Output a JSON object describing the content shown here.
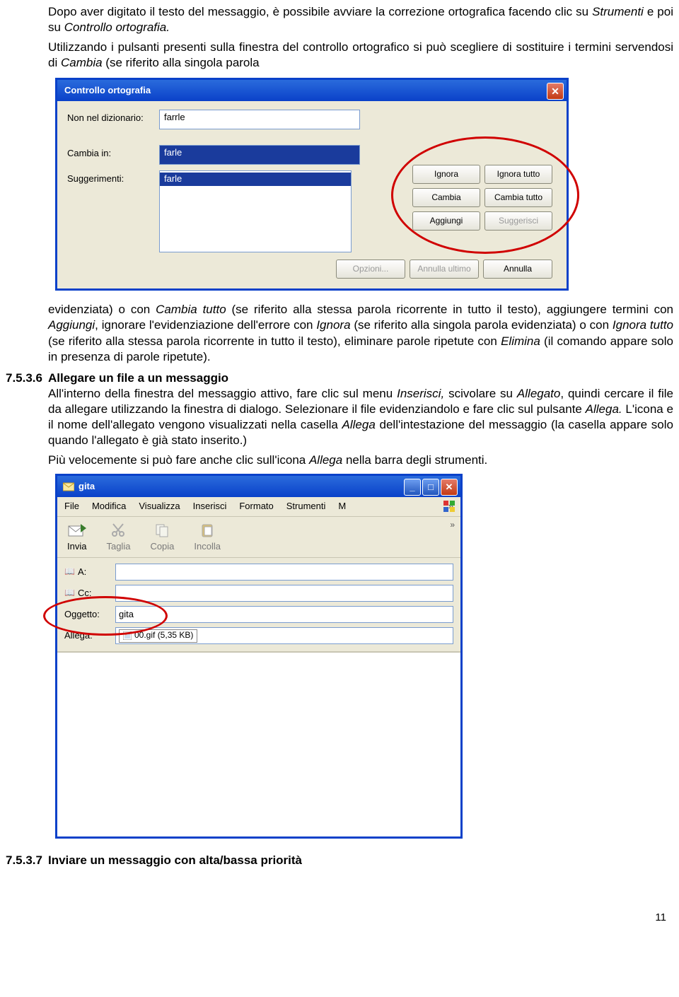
{
  "intro": {
    "p1a": "Dopo aver digitato il testo del messaggio, è possibile avviare la correzione ortografica facendo clic su ",
    "p1b": "Strumenti",
    "p1c": " e poi su ",
    "p1d": "Controllo ortografia.",
    "p2a": "Utilizzando i pulsanti presenti sulla finestra del controllo ortografico si può scegliere di sostituire i termini servendosi di ",
    "p2b": "Cambia",
    "p2c": " (se riferito alla singola parola"
  },
  "spellcheck": {
    "title": "Controllo ortografia",
    "labels": {
      "not_in_dict": "Non nel dizionario:",
      "change_to": "Cambia in:",
      "suggestions": "Suggerimenti:"
    },
    "not_in_dict_value": "farrle",
    "change_to_value": "farle",
    "suggestion_item": "farle",
    "buttons": {
      "ignore": "Ignora",
      "ignore_all": "Ignora tutto",
      "change": "Cambia",
      "change_all": "Cambia tutto",
      "add": "Aggiungi",
      "suggest": "Suggerisci",
      "options": "Opzioni...",
      "undo_last": "Annulla ultimo",
      "cancel": "Annulla"
    }
  },
  "after_spell": {
    "p1a": "evidenziata) o con ",
    "p1b": "Cambia tutto",
    "p1c": " (se riferito alla stessa parola ricorrente in tutto il testo), aggiungere termini con ",
    "p1d": "Aggiungi",
    "p1e": ", ignorare l'evidenziazione dell'errore con ",
    "p1f": "Ignora",
    "p1g": " (se riferito alla singola parola evidenziata) o con ",
    "p1h": "Ignora tutto",
    "p1i": " (se riferito alla stessa parola ricorrente in tutto il testo), eliminare parole ripetute con ",
    "p1j": "Elimina",
    "p1k": " (il comando appare solo in presenza di parole ripetute)."
  },
  "section": {
    "num": "7.5.3.6",
    "title": "Allegare un file a un messaggio",
    "p1a": "All'interno della finestra del messaggio attivo, fare clic sul menu ",
    "p1b": "Inserisci,",
    "p1c": " scivolare su ",
    "p1d": "Allegato",
    "p1e": ", quindi cercare il file da allegare utilizzando la finestra di dialogo. Selezionare il file evidenziandolo e fare clic sul pulsante ",
    "p1f": "Allega.",
    "p1g": " L'icona e il nome dell'allegato vengono visualizzati nella casella ",
    "p1h": "Allega",
    "p1i": " dell'intestazione del messaggio (la casella appare solo quando l'allegato è già stato inserito.)",
    "p2a": "Più velocemente si può fare anche clic sull'icona ",
    "p2b": "Allega",
    "p2c": " nella barra degli strumenti."
  },
  "mail": {
    "title": "gita",
    "menu": {
      "file": "File",
      "edit": "Modifica",
      "view": "Visualizza",
      "insert": "Inserisci",
      "format": "Formato",
      "tools": "Strumenti",
      "more_letter": "M"
    },
    "toolbar": {
      "send": "Invia",
      "cut": "Taglia",
      "copy": "Copia",
      "paste": "Incolla"
    },
    "fields": {
      "to": "A:",
      "cc": "Cc:",
      "subject": "Oggetto:",
      "attach": "Allega:",
      "subject_value": "gita",
      "attach_value": "00.gif (5,35 KB)"
    }
  },
  "section2": {
    "num": "7.5.3.7",
    "title": "Inviare un messaggio con alta/bassa priorità"
  },
  "page_number": "11"
}
